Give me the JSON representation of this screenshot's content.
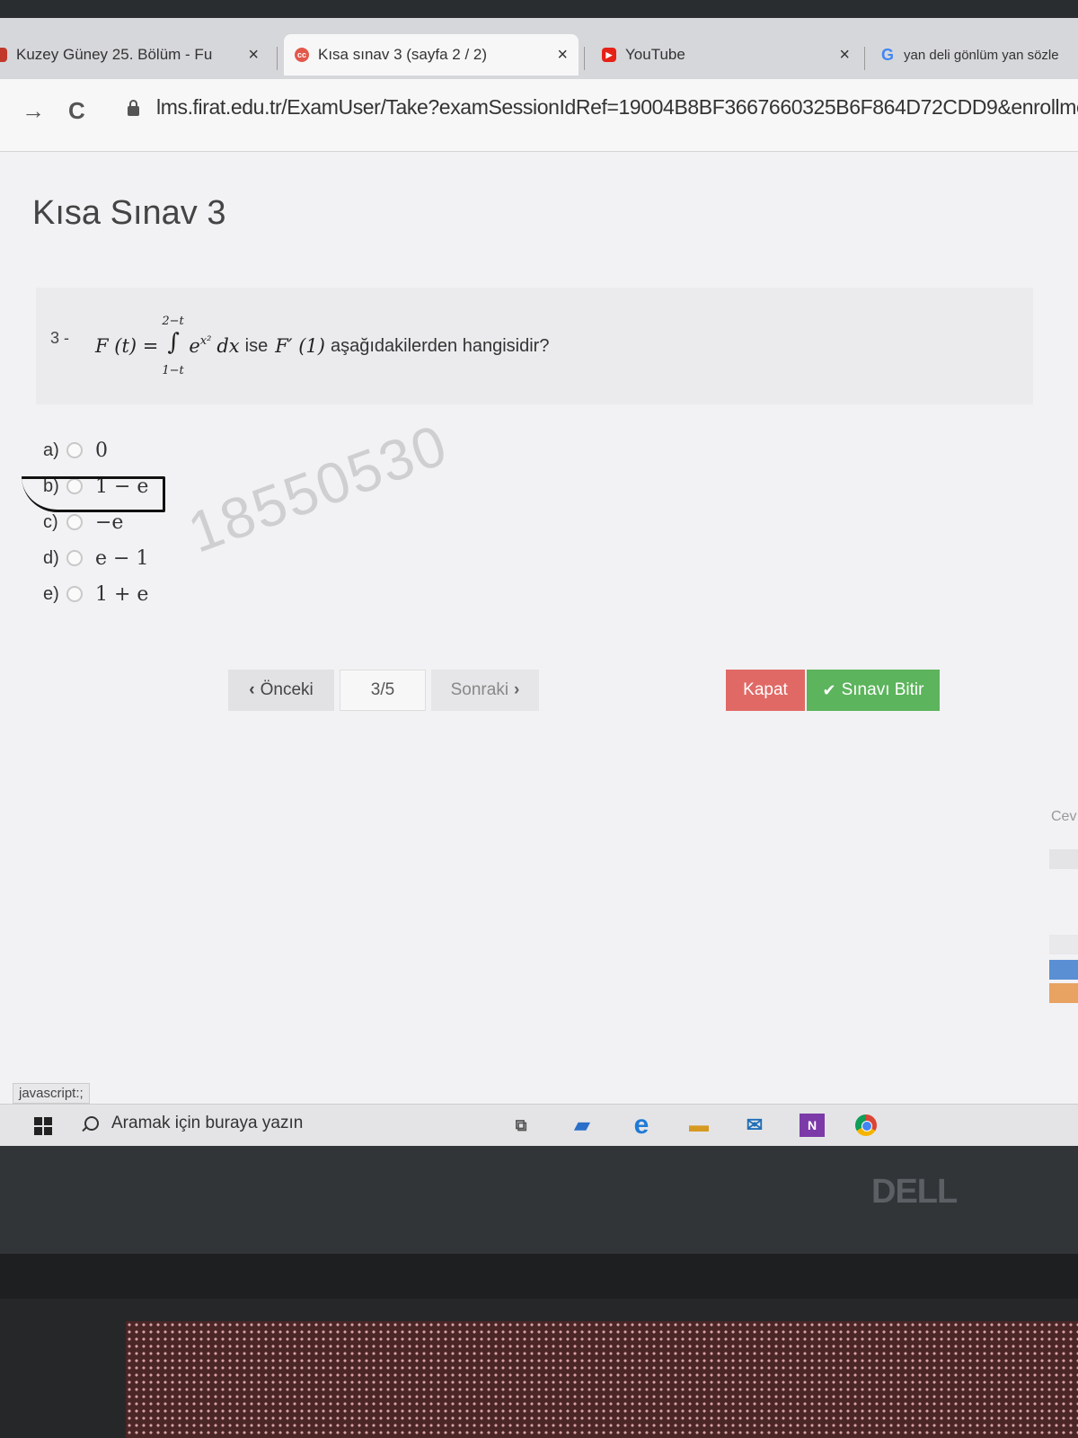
{
  "browser": {
    "tabs": [
      {
        "label": "Kuzey Güney 25. Bölüm - Fu",
        "close": "×"
      },
      {
        "label": "Kısa sınav 3 (sayfa 2 / 2)",
        "close": "×"
      },
      {
        "label": "YouTube",
        "close": "×"
      },
      {
        "label": "yan deli gönlüm yan sözle",
        "close": ""
      }
    ],
    "nav": {
      "back": "→",
      "reload": "C"
    },
    "url": "lms.firat.edu.tr/ExamUser/Take?examSessionIdRef=19004B8BF3667660325B6F864D72CDD9&enrollmentIdRef=F"
  },
  "page": {
    "title": "Kısa Sınav 3",
    "question": {
      "number": "3 -",
      "lhs": "F (t) =",
      "upper_limit": "2−t",
      "lower_limit": "1−t",
      "integral": "∫",
      "integrand": "e",
      "exponent": "x²",
      "dx": "dx",
      "ise": "ise",
      "derivative": "F′ (1)",
      "prompt": "aşağıdakilerden hangisidir?"
    },
    "options": [
      {
        "letter": "a)",
        "value": "0"
      },
      {
        "letter": "b)",
        "value": "1 − e"
      },
      {
        "letter": "c)",
        "value": "−e"
      },
      {
        "letter": "d)",
        "value": "e − 1"
      },
      {
        "letter": "e)",
        "value": "1 + e"
      }
    ],
    "watermark": "18550530",
    "pager": {
      "prev": "Önceki",
      "current": "3/5",
      "next": "Sonraki"
    },
    "actions": {
      "close": "Kapat",
      "finish": "Sınavı Bitir"
    },
    "side_panel": {
      "label": "Cev"
    }
  },
  "status_bar": "javascript:;",
  "taskbar": {
    "search_placeholder": "Aramak için buraya yazın"
  },
  "brand": "DELL",
  "colors": {
    "close_button": "#e06966",
    "finish_button": "#5cb45c",
    "youtube": "#e62117"
  }
}
